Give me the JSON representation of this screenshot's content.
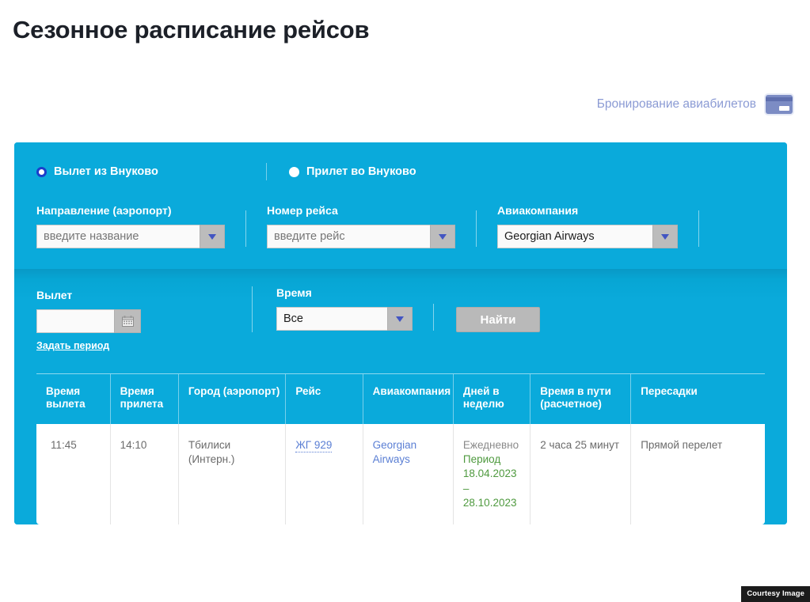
{
  "page": {
    "title": "Сезонное расписание рейсов"
  },
  "booking": {
    "label": "Бронирование авиабилетов",
    "icon": "credit-card-icon"
  },
  "search_panel": {
    "direction_options": [
      {
        "label": "Вылет из Внуково",
        "selected": true
      },
      {
        "label": "Прилет во Внуково",
        "selected": false
      }
    ],
    "fields": {
      "destination": {
        "label": "Направление (аэропорт)",
        "value": "",
        "placeholder": "введите название"
      },
      "flight_number": {
        "label": "Номер рейса",
        "value": "",
        "placeholder": "введите рейс"
      },
      "airline": {
        "label": "Авиакомпания",
        "value": "Georgian Airways",
        "placeholder": ""
      },
      "departure_date": {
        "label": "Вылет",
        "value": "",
        "placeholder": "",
        "calendar_icon": "calendar-icon",
        "period_link": "Задать период"
      },
      "time": {
        "label": "Время",
        "value": "Все"
      }
    },
    "search_button": "Найти"
  },
  "results_table": {
    "columns": [
      "Время вылета",
      "Время прилета",
      "Город (аэропорт)",
      "Рейс",
      "Авиакомпания",
      "Дней в неделю",
      "Время в пути (расчетное)",
      "Пересадки"
    ],
    "rows": [
      {
        "departure_time": "11:45",
        "arrival_time": "14:10",
        "city_airport": "Тбилиси (Интерн.)",
        "flight": "ЖГ 929",
        "airline": "Georgian Airways",
        "frequency": "Ежедневно",
        "period": "Период 18.04.2023 – 28.10.2023",
        "duration": "2 часа 25 минут",
        "transfers": "Прямой перелет"
      }
    ]
  },
  "watermark": {
    "text": "Courtesy Image"
  },
  "colors": {
    "panel_top": "#0aaadb",
    "panel_bottom": "#0aaadb",
    "accent_link": "#5b7fd4",
    "period_green": "#4f9a3f",
    "radio_selected": "#1a3ecb",
    "button_gray": "#b9b9b9"
  }
}
